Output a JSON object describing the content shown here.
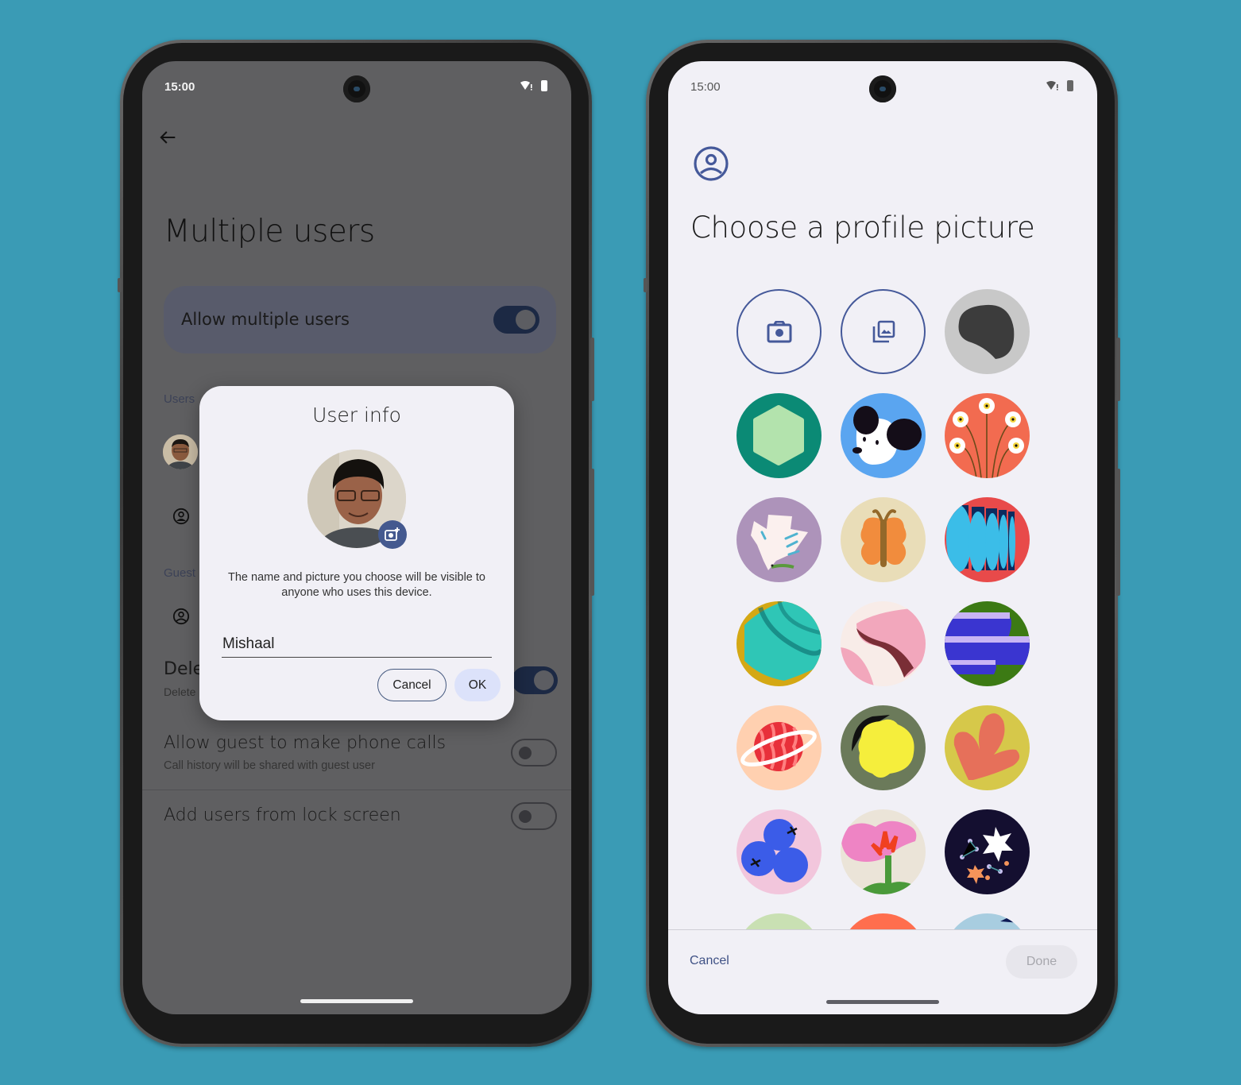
{
  "left_phone": {
    "status_bar": {
      "time": "15:00",
      "icons": [
        "wifi-alert-icon",
        "battery-icon"
      ]
    },
    "back_icon": "arrow-back-icon",
    "page_title": "Multiple users",
    "main_switch": {
      "label": "Allow multiple users",
      "on": true
    },
    "sections": {
      "users_label": "Users",
      "guest_label": "Guest"
    },
    "delete_row": {
      "title_partial": "Dele",
      "subtitle_partial": "Delete",
      "on": true
    },
    "settings": [
      {
        "title": "Allow guest to make phone calls",
        "subtitle": "Call history will be shared with guest user",
        "on": false
      },
      {
        "title": "Add users from lock screen",
        "subtitle": "",
        "on": false
      }
    ],
    "dialog": {
      "title": "User info",
      "message": "The name and picture you choose will be visible to anyone who uses this device.",
      "name_value": "Mishaal",
      "cancel_label": "Cancel",
      "ok_label": "OK"
    }
  },
  "right_phone": {
    "status_bar": {
      "time": "15:00",
      "icons": [
        "wifi-alert-icon",
        "battery-icon"
      ]
    },
    "header_icon": "account-circle-icon",
    "title": "Choose a profile picture",
    "options": [
      {
        "name": "take-photo",
        "icon": "camera-icon"
      },
      {
        "name": "choose-image",
        "icon": "photo-library-icon"
      },
      {
        "name": "avatar-blob",
        "colors": [
          "#c8c8c8",
          "#3c3c3c"
        ]
      },
      {
        "name": "avatar-hexagon",
        "colors": [
          "#0b8a75",
          "#b3e3ad"
        ]
      },
      {
        "name": "avatar-dog",
        "colors": [
          "#5aa5f0",
          "#ffffff",
          "#140d18"
        ]
      },
      {
        "name": "avatar-flowers",
        "colors": [
          "#f26b50",
          "#ffffff",
          "#f5d63d"
        ]
      },
      {
        "name": "avatar-dove",
        "colors": [
          "#ad93ba",
          "#fbf0ee",
          "#5a9a3c"
        ]
      },
      {
        "name": "avatar-butterfly",
        "colors": [
          "#e9ddb8",
          "#f18c3d",
          "#93682a"
        ]
      },
      {
        "name": "avatar-pages",
        "colors": [
          "#e84a4a",
          "#3bbde8",
          "#0d2b5e"
        ]
      },
      {
        "name": "avatar-teal-waves",
        "colors": [
          "#d4a814",
          "#2fc6b6",
          "#0b6b6b"
        ]
      },
      {
        "name": "avatar-pink-waves",
        "colors": [
          "#f8ece8",
          "#f2a7bc",
          "#7a2e36"
        ]
      },
      {
        "name": "avatar-blue-layers",
        "colors": [
          "#3c7a14",
          "#3a35d0",
          "#c8b5f4"
        ]
      },
      {
        "name": "avatar-planet",
        "colors": [
          "#ffd0b0",
          "#e8303a",
          "#ffffff"
        ]
      },
      {
        "name": "avatar-lemon",
        "colors": [
          "#6b7a5a",
          "#f5ee3c",
          "#111111"
        ]
      },
      {
        "name": "avatar-leaf",
        "colors": [
          "#d6c84a",
          "#e6705a"
        ]
      },
      {
        "name": "avatar-blueberries",
        "colors": [
          "#f2c6dc",
          "#3b5ce8",
          "#111111"
        ]
      },
      {
        "name": "avatar-pink-flower",
        "colors": [
          "#ebe4d8",
          "#ee84c4",
          "#f04020",
          "#4a9a3a"
        ]
      },
      {
        "name": "avatar-stars",
        "colors": [
          "#140f30",
          "#ffffff",
          "#f4945a",
          "#c8c0f0"
        ]
      },
      {
        "name": "avatar-partial-green",
        "colors": [
          "#c9e0b3"
        ]
      },
      {
        "name": "avatar-partial-orange",
        "colors": [
          "#ff6e4e"
        ]
      },
      {
        "name": "avatar-partial-blue",
        "colors": [
          "#a8cde0",
          "#0d1a55"
        ]
      }
    ],
    "cancel_label": "Cancel",
    "done_label": "Done",
    "done_enabled": false
  },
  "colors": {
    "background": "#3a9bb5",
    "accent": "#45599a",
    "switch_on": "#1c2944"
  }
}
